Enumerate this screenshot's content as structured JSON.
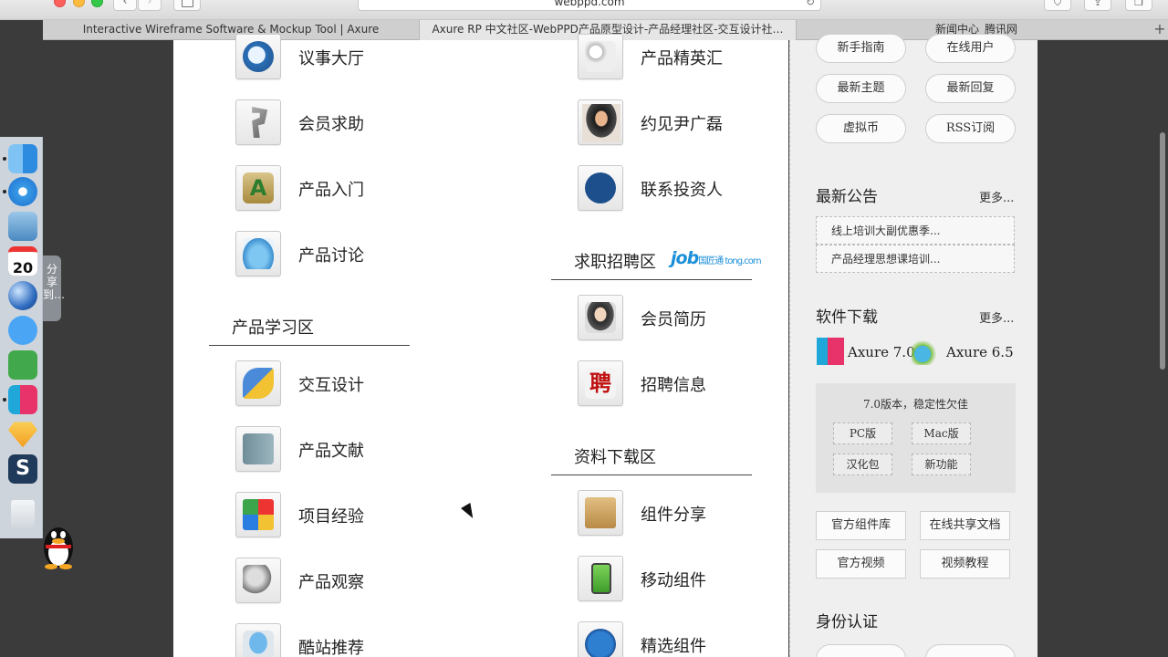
{
  "browser": {
    "address": "webppd.com",
    "tabs": [
      "Interactive Wireframe Software & Mockup Tool | Axure",
      "Axure RP 中文社区-WebPPD产品原型设计-产品经理社区-交互设计社…",
      "新闻中心_腾讯网"
    ],
    "active_tab": 1,
    "add_tab": "+"
  },
  "dock": {
    "calendar_day": "20",
    "share_label": "分享到…"
  },
  "left_column": {
    "items_top": [
      "议事大厅",
      "会员求助",
      "产品入门",
      "产品讨论"
    ],
    "section_learning": "产品学习区",
    "items_learning": [
      "交互设计",
      "产品文献",
      "项目经验",
      "产品观察",
      "酷站推荐"
    ]
  },
  "right_column": {
    "items_top": [
      "产品精英汇",
      "约见尹广磊",
      "联系投资人"
    ],
    "section_jobs": "求职招聘区",
    "job_logo": "job",
    "job_logo_small": "国匠通 tong.com",
    "items_jobs": [
      "会员简历",
      "招聘信息"
    ],
    "section_download": "资料下载区",
    "items_download": [
      "组件分享",
      "移动组件",
      "精选组件"
    ]
  },
  "sidebar": {
    "pills": [
      "新手指南",
      "在线用户",
      "最新主题",
      "最新回复",
      "虚拟币",
      "RSS订阅"
    ],
    "announcements_title": "最新公告",
    "more": "更多...",
    "announcements": [
      "线上培训大副优惠季...",
      "产品经理思想课培训..."
    ],
    "downloads_title": "软件下载",
    "downloads": [
      "Axure 7.0",
      "Axure 6.5"
    ],
    "download_desc": "7.0版本，稳定性欠佳",
    "download_buttons": [
      "PC版",
      "Mac版",
      "汉化包",
      "新功能"
    ],
    "links": [
      "官方组件库",
      "在线共享文档",
      "官方视频",
      "视频教程"
    ],
    "identity_title": "身份认证"
  },
  "colors": {
    "accent_blue": "#1b8fd8",
    "traffic_close": "#fc605c",
    "traffic_min": "#fdbc40",
    "traffic_max": "#34c84a"
  }
}
